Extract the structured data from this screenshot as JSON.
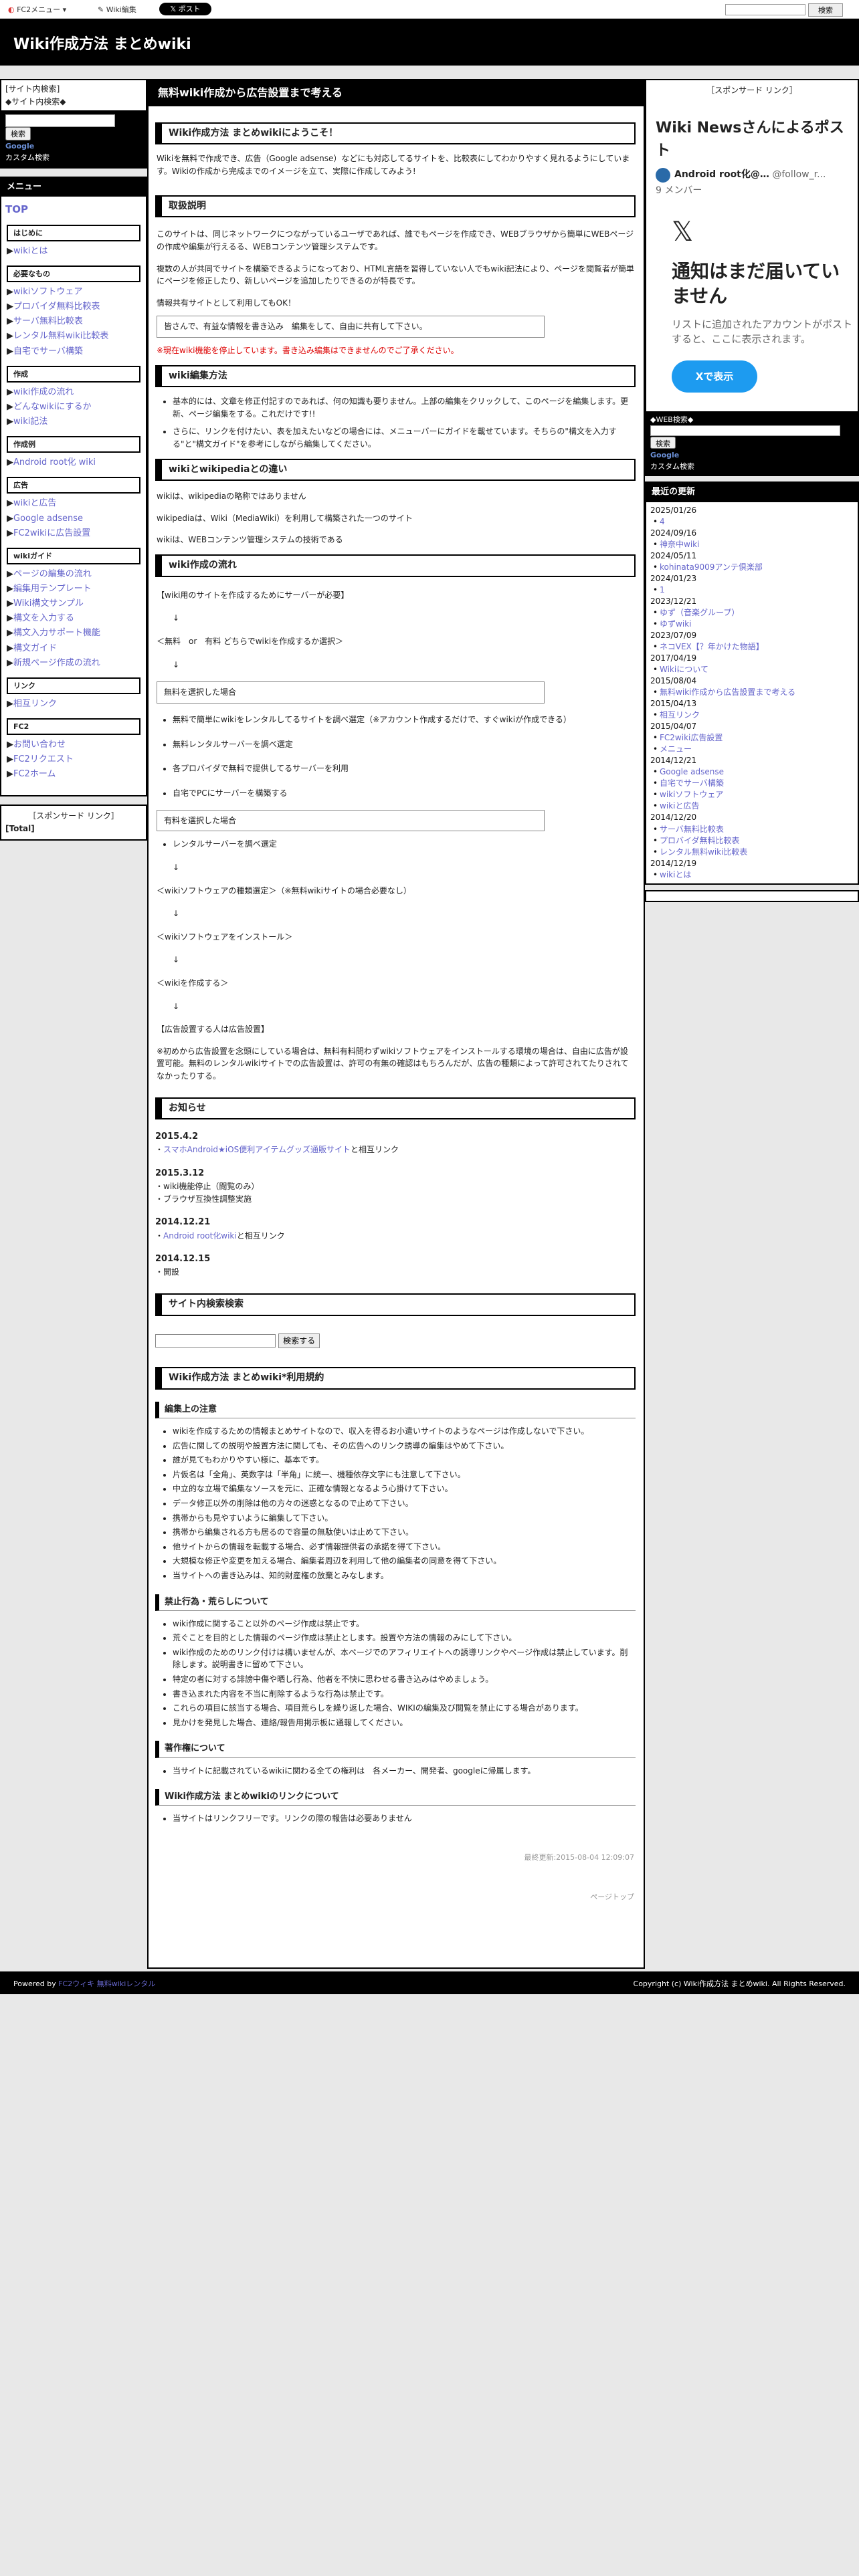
{
  "topbar": {
    "menu": "FC2メニュー ▾",
    "edit": "Wiki編集",
    "post": "𝕏 ポスト",
    "search_btn": "検索"
  },
  "header": {
    "title": "Wiki作成方法 まとめwiki"
  },
  "left": {
    "search_caption": "[サイト内検索]",
    "search_title": "◆サイト内検索◆",
    "search_btn": "検索",
    "google": "Google",
    "custom": "カスタム検索",
    "menu_head": "メニュー",
    "top": "TOP",
    "sections": [
      {
        "title": "はじめに",
        "items": [
          "wikiとは"
        ]
      },
      {
        "title": "必要なもの",
        "items": [
          "wikiソフトウェア",
          "プロバイダ無料比較表",
          "サーバ無料比較表",
          "レンタル無料wiki比較表",
          "自宅でサーバ構築"
        ]
      },
      {
        "title": "作成",
        "items": [
          "wiki作成の流れ",
          "どんなwikiにするか",
          "wiki記法"
        ]
      },
      {
        "title": "作成例",
        "items": [
          "Android root化 wiki"
        ]
      },
      {
        "title": "広告",
        "items": [
          "wikiと広告",
          "Google adsense",
          "FC2wikiに広告設置"
        ]
      },
      {
        "title": "wikiガイド",
        "items": [
          "ページの編集の流れ",
          "編集用テンプレート",
          "Wiki構文サンプル",
          "構文を入力する",
          "構文入力サポート機能",
          "構文ガイド",
          "新規ページ作成の流れ"
        ]
      },
      {
        "title": "リンク",
        "items": [
          "相互リンク"
        ]
      },
      {
        "title": "FC2",
        "items": [
          "お問い合わせ",
          "FC2リクエスト",
          "FC2ホーム"
        ]
      }
    ],
    "sponsor": "［スポンサード リンク］",
    "total": "[Total]"
  },
  "main": {
    "title": "無料wiki作成から広告設置まで考える",
    "welcome": "Wiki作成方法 まとめwikiにようこそ！",
    "intro": "Wikiを無料で作成でき、広告（Google adsense）などにも対応してるサイトを、比較表にしてわかりやすく見れるようにしています。Wikiの作成から完成までのイメージを立て、実際に作成してみよう!",
    "h_about": "取扱説明",
    "about_p1": "このサイトは、同じネットワークにつながっているユーザであれば、誰でもページを作成でき、WEBブラウザから簡単にWEBページの作成や編集が行えるる、WEBコンテンツ管理システムです。",
    "about_p2": "複数の人が共同でサイトを構築できるようになっており、HTML言語を習得していない人でもwiki記法により、ページを閲覧者が簡単にページを修正したり、新しいページを追加したりできるのが特長です。",
    "about_p3": "情報共有サイトとして利用してもOK！",
    "about_quote": "皆さんで、有益な情報を書き込み　編集をして、自由に共有して下さい。",
    "about_red": "※現在wiki機能を停止しています。書き込み編集はできませんのでご了承ください。",
    "h_edit": "wiki編集方法",
    "edit_items": [
      "基本的には、文章を修正付記すのであれば、何の知識も要りません。上部の編集をクリックして、このページを編集します。更新、ページ編集をする。これだけです!!",
      "さらに、リンクを付けたい、表を加えたいなどの場合には、メニューバーにガイドを載せています。そちらの\"構文を入力する\"と\"構文ガイド\"を参考にしながら編集してください。"
    ],
    "h_diff": "wikiとwikipediaとの違い",
    "diff_p1": "wikiは、wikipediaの略称ではありません",
    "diff_p2": "wikipediaは、Wiki（MediaWiki）を利用して構築された一つのサイト",
    "diff_p3": "wikiは、WEBコンテンツ管理システムの技術である",
    "h_flow": "wiki作成の流れ",
    "flow_1": "【wiki用のサイトを作成するためにサーバーが必要】",
    "arrow": "↓",
    "flow_2": "＜無料　or　有料 どちらでwikiを作成するか選択＞",
    "flow_free": "無料を選択した場合",
    "free_items": [
      "無料で簡単にwikiをレンタルしてるサイトを調べ選定（※アカウント作成するだけで、すぐwikiが作成できる）",
      "無料レンタルサーバーを調べ選定",
      "各プロバイダで無料で提供してるサーバーを利用",
      "自宅でPCにサーバーを構築する"
    ],
    "flow_paid": "有料を選択した場合",
    "paid_items": [
      "レンタルサーバーを調べ選定"
    ],
    "flow_3": "＜wikiソフトウェアの種類選定＞（※無料wikiサイトの場合必要なし）",
    "flow_4": "＜wikiソフトウェアをインストール＞",
    "flow_5": "＜wikiを作成する＞",
    "flow_6": "【広告設置する人は広告設置】",
    "flow_note": "※初めから広告設置を念頭にしている場合は、無料有料問わずwikiソフトウェアをインストールする環境の場合は、自由に広告が設置可能。無料のレンタルwikiサイトでの広告設置は、許可の有無の確認はもちろんだが、広告の種類によって許可されてたりされてなかったりする。",
    "h_news": "お知らせ",
    "news": [
      {
        "date": "2015.4.2",
        "lines": [
          {
            "pre": "・",
            "link": "スマホAndroid★iOS便利アイテムグッズ通販サイト",
            "post": "と相互リンク"
          }
        ]
      },
      {
        "date": "2015.3.12",
        "lines": [
          {
            "pre": "・wiki機能停止（閲覧のみ）",
            "link": "",
            "post": ""
          },
          {
            "pre": "・ブラウザ互換性調整実施",
            "link": "",
            "post": ""
          }
        ]
      },
      {
        "date": "2014.12.21",
        "lines": [
          {
            "pre": "・",
            "link": "Android root化wiki",
            "post": "と相互リンク"
          }
        ]
      },
      {
        "date": "2014.12.15",
        "lines": [
          {
            "pre": "・開設",
            "link": "",
            "post": ""
          }
        ]
      }
    ],
    "h_search": "サイト内検索検索",
    "search_btn": "検索する",
    "h_rules": "Wiki作成方法 まとめwiki*利用規約",
    "h_rules_edit": "編集上の注意",
    "rules_edit": [
      "wikiを作成するための情報まとめサイトなので、収入を得るお小遣いサイトのようなページは作成しないで下さい。",
      "広告に関しての説明や設置方法に関しても、その広告へのリンク誘導の編集はやめて下さい。",
      "誰が見てもわかりやすい様に、基本です。",
      "片仮名は「全角」、英数字は「半角」に統一、機種依存文字にも注意して下さい。",
      "中立的な立場で編集なソースを元に、正確な情報となるよう心掛けて下さい。",
      "データ修正以外の削除は他の方々の迷惑となるので止めて下さい。",
      "携帯からも見やすいように編集して下さい。",
      "携帯から編集される方も居るので容量の無駄使いは止めて下さい。",
      "他サイトからの情報を転載する場合、必ず情報提供者の承諾を得て下さい。",
      "大規模な修正や変更を加える場合、編集者周辺を利用して他の編集者の同意を得て下さい。",
      "当サイトへの書き込みは、知的財産権の放棄とみなします。"
    ],
    "h_rules_ban": "禁止行為・荒らしについて",
    "rules_ban": [
      "wiki作成に関すること以外のページ作成は禁止です。",
      "荒ぐことを目的とした情報のページ作成は禁止とします。設置や方法の情報のみにして下さい。",
      "wiki作成のためのリンク付けは構いませんが、本ページでのアフィリエイトへの誘導リンクやページ作成は禁止しています。削除します。説明書きに留めて下さい。",
      "特定の者に対する誹謗中傷や晒し行為、他者を不快に思わせる書き込みはやめましょう。",
      "書き込まれた内容を不当に削除するような行為は禁止です。",
      "これらの項目に該当する場合、項目荒らしを繰り返した場合、WIKIの編集及び閲覧を禁止にする場合があります。",
      "見かけを発見した場合、連絡/報告用掲示板に通報してください。"
    ],
    "h_copyright": "著作権について",
    "copyright": [
      "当サイトに記載されているwikiに関わる全ての権利は　各メーカー、開発者、googleに帰属します。"
    ],
    "h_link": "Wiki作成方法 まとめwikiのリンクについて",
    "link_items": [
      "当サイトはリンクフリーです。リンクの際の報告は必要ありません"
    ],
    "lastmod": "最終更新:2015-08-04 12:09:07",
    "pagetop": "ページトップ"
  },
  "right": {
    "sponsor": "［スポンサード リンク］",
    "tw_title": "Wiki Newsさんによるポスト",
    "tw_account": "Android root化@…",
    "tw_handle": "@follow_r...",
    "tw_members": "9 メンバー",
    "tw_big": "通知はまだ届いていません",
    "tw_sub": "リストに追加されたアカウントがポストすると、ここに表示されます。",
    "tw_btn": "Xで表示",
    "search_title": "◆WEB検索◆",
    "search_btn": "検索",
    "google": "Google",
    "custom": "カスタム検索",
    "upd_head": "最近の更新",
    "updates": [
      {
        "date": "2025/01/26",
        "items": [
          "4"
        ]
      },
      {
        "date": "2024/09/16",
        "items": [
          "神奈中wiki"
        ]
      },
      {
        "date": "2024/05/11",
        "items": [
          "kohinata9009アンテ倶楽部"
        ]
      },
      {
        "date": "2024/01/23",
        "items": [
          "1"
        ]
      },
      {
        "date": "2023/12/21",
        "items": [
          "ゆず（音楽グループ）",
          "ゆずwiki"
        ]
      },
      {
        "date": "2023/07/09",
        "items": [
          "ネコVEX【？年かけた物語】"
        ]
      },
      {
        "date": "2017/04/19",
        "items": [
          "Wikiについて"
        ]
      },
      {
        "date": "2015/08/04",
        "items": [
          "無料wiki作成から広告設置まで考える"
        ]
      },
      {
        "date": "2015/04/13",
        "items": [
          "相互リンク"
        ]
      },
      {
        "date": "2015/04/07",
        "items": [
          "FC2wiki広告設置",
          "メニュー"
        ]
      },
      {
        "date": "2014/12/21",
        "items": [
          "Google adsense",
          "自宅でサーバ構築",
          "wikiソフトウェア",
          "wikiと広告"
        ]
      },
      {
        "date": "2014/12/20",
        "items": [
          "サーバ無料比較表",
          "プロバイダ無料比較表",
          "レンタル無料wiki比較表"
        ]
      },
      {
        "date": "2014/12/19",
        "items": [
          "wikiとは"
        ]
      }
    ]
  },
  "footer": {
    "powered_pre": "Powered by ",
    "powered_link": "FC2ウィキ 無料wikiレンタル",
    "copyright": "Copyright (c) Wiki作成方法 まとめwiki. All Rights Reserved."
  }
}
